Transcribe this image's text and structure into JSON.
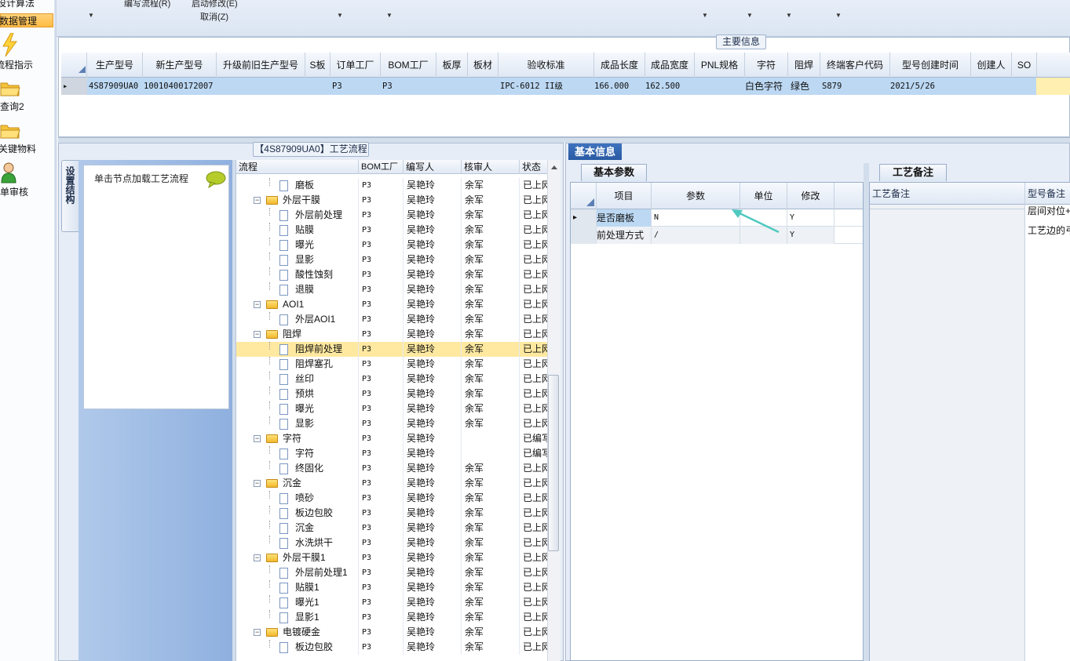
{
  "nav": {
    "items": [
      {
        "label": "设计算法",
        "icon": "none",
        "selected": false
      },
      {
        "label": "数据管理",
        "icon": "none",
        "selected": true
      },
      {
        "label": "流程指示",
        "icon": "lightning-icon",
        "selected": false
      },
      {
        "label": "查询2",
        "icon": "folder-icon",
        "selected": false
      },
      {
        "label": "关键物料",
        "icon": "folder-icon",
        "selected": false
      },
      {
        "label": "单审核",
        "icon": "user-icon",
        "selected": false
      }
    ]
  },
  "toolbar": {
    "edit_flow": "编写流程(R)",
    "start_modify": "启动修改(E)",
    "cancel": "取消(Z)"
  },
  "main_info": {
    "title": "主要信息",
    "columns": [
      "生产型号",
      "新生产型号",
      "升级前旧生产型号",
      "S板",
      "订单工厂",
      "BOM工厂",
      "板厚",
      "板材",
      "验收标准",
      "成品长度",
      "成品宽度",
      "PNL规格",
      "字符",
      "阻焊",
      "终端客户代码",
      "型号创建时间",
      "创建人",
      "SO"
    ],
    "row": {
      "model": "4S87909UA0",
      "new_model": "10010400172007",
      "old_model": "",
      "s_board": "",
      "order_factory": "P3",
      "bom_factory": "P3",
      "thickness": "",
      "material": "",
      "standard": "IPC-6012 II级",
      "length": "166.000",
      "width": "162.500",
      "pnl": "",
      "char": "白色字符",
      "solder_mask": "绿色",
      "customer_code": "S879",
      "created_time": "2021/5/26",
      "creator": "",
      "so": ""
    }
  },
  "process": {
    "title": "【4S87909UA0】工艺流程",
    "vtab_label": "设置结构",
    "load_hint": "单击节点加载工艺流程",
    "columns": [
      "流程",
      "BOM工厂",
      "编写人",
      "核审人",
      "状态"
    ],
    "rows": [
      {
        "level": 1,
        "type": "file",
        "name": "磨板",
        "bom": "P3",
        "writer": "吴艳玲",
        "reviewer": "余军",
        "status": "已上网"
      },
      {
        "level": 0,
        "type": "folder",
        "name": "外层干膜",
        "bom": "P3",
        "writer": "吴艳玲",
        "reviewer": "余军",
        "status": "已上网"
      },
      {
        "level": 1,
        "type": "file",
        "name": "外层前处理",
        "bom": "P3",
        "writer": "吴艳玲",
        "reviewer": "余军",
        "status": "已上网"
      },
      {
        "level": 1,
        "type": "file",
        "name": "贴膜",
        "bom": "P3",
        "writer": "吴艳玲",
        "reviewer": "余军",
        "status": "已上网"
      },
      {
        "level": 1,
        "type": "file",
        "name": "曝光",
        "bom": "P3",
        "writer": "吴艳玲",
        "reviewer": "余军",
        "status": "已上网"
      },
      {
        "level": 1,
        "type": "file",
        "name": "显影",
        "bom": "P3",
        "writer": "吴艳玲",
        "reviewer": "余军",
        "status": "已上网"
      },
      {
        "level": 1,
        "type": "file",
        "name": "酸性蚀刻",
        "bom": "P3",
        "writer": "吴艳玲",
        "reviewer": "余军",
        "status": "已上网"
      },
      {
        "level": 1,
        "type": "file",
        "name": "退膜",
        "bom": "P3",
        "writer": "吴艳玲",
        "reviewer": "余军",
        "status": "已上网"
      },
      {
        "level": 0,
        "type": "folder",
        "name": "AOI1",
        "bom": "P3",
        "writer": "吴艳玲",
        "reviewer": "余军",
        "status": "已上网"
      },
      {
        "level": 1,
        "type": "file",
        "name": "外层AOI1",
        "bom": "P3",
        "writer": "吴艳玲",
        "reviewer": "余军",
        "status": "已上网"
      },
      {
        "level": 0,
        "type": "folder",
        "name": "阻焊",
        "bom": "P3",
        "writer": "吴艳玲",
        "reviewer": "余军",
        "status": "已上网"
      },
      {
        "level": 1,
        "type": "file",
        "name": "阻焊前处理",
        "bom": "P3",
        "writer": "吴艳玲",
        "reviewer": "余军",
        "status": "已上网",
        "selected": true
      },
      {
        "level": 1,
        "type": "file",
        "name": "阻焊塞孔",
        "bom": "P3",
        "writer": "吴艳玲",
        "reviewer": "余军",
        "status": "已上网"
      },
      {
        "level": 1,
        "type": "file",
        "name": "丝印",
        "bom": "P3",
        "writer": "吴艳玲",
        "reviewer": "余军",
        "status": "已上网"
      },
      {
        "level": 1,
        "type": "file",
        "name": "预烘",
        "bom": "P3",
        "writer": "吴艳玲",
        "reviewer": "余军",
        "status": "已上网"
      },
      {
        "level": 1,
        "type": "file",
        "name": "曝光",
        "bom": "P3",
        "writer": "吴艳玲",
        "reviewer": "余军",
        "status": "已上网"
      },
      {
        "level": 1,
        "type": "file",
        "name": "显影",
        "bom": "P3",
        "writer": "吴艳玲",
        "reviewer": "余军",
        "status": "已上网"
      },
      {
        "level": 0,
        "type": "folder",
        "name": "字符",
        "bom": "P3",
        "writer": "吴艳玲",
        "reviewer": "",
        "status": "已编写"
      },
      {
        "level": 1,
        "type": "file",
        "name": "字符",
        "bom": "P3",
        "writer": "吴艳玲",
        "reviewer": "",
        "status": "已编写"
      },
      {
        "level": 1,
        "type": "file",
        "name": "终固化",
        "bom": "P3",
        "writer": "吴艳玲",
        "reviewer": "余军",
        "status": "已上网"
      },
      {
        "level": 0,
        "type": "folder",
        "name": "沉金",
        "bom": "P3",
        "writer": "吴艳玲",
        "reviewer": "余军",
        "status": "已上网"
      },
      {
        "level": 1,
        "type": "file",
        "name": "喷砂",
        "bom": "P3",
        "writer": "吴艳玲",
        "reviewer": "余军",
        "status": "已上网"
      },
      {
        "level": 1,
        "type": "file",
        "name": "板边包胶",
        "bom": "P3",
        "writer": "吴艳玲",
        "reviewer": "余军",
        "status": "已上网"
      },
      {
        "level": 1,
        "type": "file",
        "name": "沉金",
        "bom": "P3",
        "writer": "吴艳玲",
        "reviewer": "余军",
        "status": "已上网"
      },
      {
        "level": 1,
        "type": "file",
        "name": "水洗烘干",
        "bom": "P3",
        "writer": "吴艳玲",
        "reviewer": "余军",
        "status": "已上网"
      },
      {
        "level": 0,
        "type": "folder",
        "name": "外层干膜1",
        "bom": "P3",
        "writer": "吴艳玲",
        "reviewer": "余军",
        "status": "已上网"
      },
      {
        "level": 1,
        "type": "file",
        "name": "外层前处理1",
        "bom": "P3",
        "writer": "吴艳玲",
        "reviewer": "余军",
        "status": "已上网"
      },
      {
        "level": 1,
        "type": "file",
        "name": "贴膜1",
        "bom": "P3",
        "writer": "吴艳玲",
        "reviewer": "余军",
        "status": "已上网"
      },
      {
        "level": 1,
        "type": "file",
        "name": "曝光1",
        "bom": "P3",
        "writer": "吴艳玲",
        "reviewer": "余军",
        "status": "已上网"
      },
      {
        "level": 1,
        "type": "file",
        "name": "显影1",
        "bom": "P3",
        "writer": "吴艳玲",
        "reviewer": "余军",
        "status": "已上网"
      },
      {
        "level": 0,
        "type": "folder",
        "name": "电镀硬金",
        "bom": "P3",
        "writer": "吴艳玲",
        "reviewer": "余军",
        "status": "已上网"
      },
      {
        "level": 1,
        "type": "file",
        "name": "板边包胶",
        "bom": "P3",
        "writer": "吴艳玲",
        "reviewer": "余军",
        "status": "已上网"
      }
    ]
  },
  "basic_info": {
    "title": "基本信息",
    "params_tab": "基本参数",
    "notes_tab": "工艺备注",
    "param_columns": [
      "项目",
      "参数",
      "单位",
      "修改"
    ],
    "params": [
      {
        "item": "是否磨板",
        "value": "N",
        "unit": "",
        "modify": "Y"
      },
      {
        "item": "前处理方式",
        "value": "/",
        "unit": "",
        "modify": "Y"
      }
    ],
    "notes_columns": [
      "工艺备注",
      "型号备注"
    ],
    "notes_lines": [
      "层间对位+",
      "工艺边的弓"
    ]
  }
}
